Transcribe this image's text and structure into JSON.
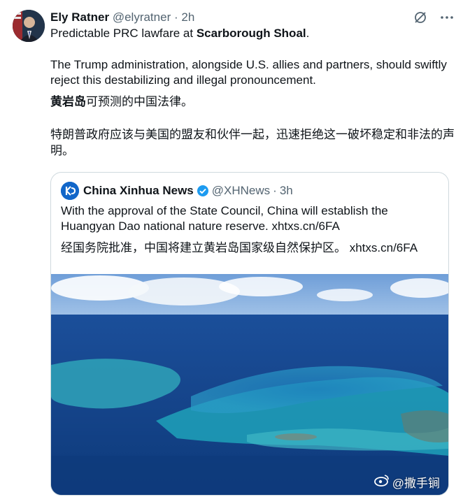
{
  "author": {
    "name": "Ely Ratner",
    "handle": "@elyratner",
    "separator": "·",
    "time": "2h"
  },
  "tweet": {
    "line1_prefix": "Predictable PRC lawfare at ",
    "line1_bold": "Scarborough Shoal",
    "line1_suffix": ".",
    "para2_line1": "The Trump administration, alongside U.S. allies and partners, should swiftly",
    "para2_line2": "reject this destabilizing and illegal pronouncement.",
    "zh1_bold": "黄岩岛",
    "zh1_rest": "可预测的中国法律。",
    "zh2_line1": "特朗普政府应该与美国的盟友和伙伴一起，迅速拒绝这一破坏稳定和非法的声",
    "zh2_line2": "明。"
  },
  "quote": {
    "name": "China Xinhua News",
    "handle": "@XHNews",
    "separator": "·",
    "time": "3h",
    "en_line1": "With the approval of the State Council, China will establish the",
    "en_line2": "Huangyan Dao national nature reserve. xhtxs.cn/6FA",
    "zh_line": "经国务院批准，中国将建立黄岩岛国家级自然保护区。  xhtxs.cn/6FA"
  },
  "watermark": "@撒手锏",
  "icons": [
    "grok-icon",
    "more-icon",
    "verified-badge-icon",
    "weibo-icon"
  ],
  "colors": {
    "text": "#0f1419",
    "secondary": "#536471",
    "verified": "#1d9bf0",
    "border": "#cfd9de"
  }
}
